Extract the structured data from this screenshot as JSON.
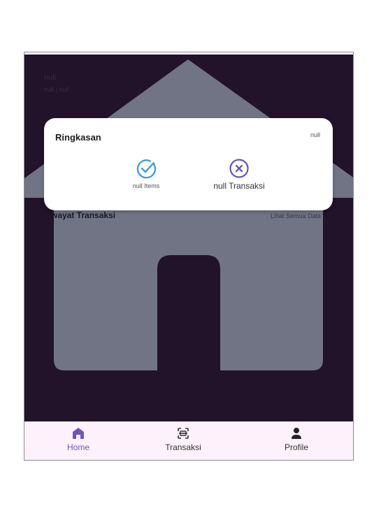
{
  "header": {
    "title": "null",
    "subtitle": "null | null"
  },
  "summary": {
    "title": "Ringkasan",
    "right_value": "null",
    "items_label": "null Items",
    "transactions_label": "null Transaksi",
    "items_icon": "check-circle-icon",
    "transactions_icon": "x-circle-icon"
  },
  "history": {
    "title": "Riwayat Transaksi",
    "see_all": "Lihat Semua Data"
  },
  "nav": {
    "home": "Home",
    "transaksi": "Transaksi",
    "profile": "Profile"
  },
  "colors": {
    "accent": "#6c57b8",
    "background": "#22122a",
    "nav_background": "#fdf2fb",
    "house": "#717485"
  }
}
